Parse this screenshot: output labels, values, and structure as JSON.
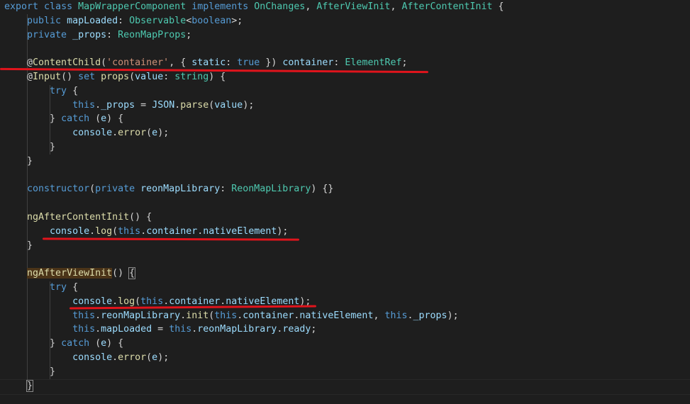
{
  "editor": {
    "lines": [
      [
        {
          "t": "export",
          "c": "kw"
        },
        {
          "t": " class ",
          "c": "kw"
        },
        {
          "t": "MapWrapperComponent",
          "c": "ty"
        },
        {
          "t": " implements ",
          "c": "kw"
        },
        {
          "t": "OnChanges",
          "c": "ty"
        },
        {
          "t": ", ",
          "c": "pl"
        },
        {
          "t": "AfterViewInit",
          "c": "ty"
        },
        {
          "t": ", ",
          "c": "pl"
        },
        {
          "t": "AfterContentInit",
          "c": "ty"
        },
        {
          "t": " {",
          "c": "pl"
        }
      ],
      [
        {
          "t": "    public ",
          "c": "kw"
        },
        {
          "t": "mapLoaded",
          "c": "va"
        },
        {
          "t": ": ",
          "c": "pl"
        },
        {
          "t": "Observable",
          "c": "ty"
        },
        {
          "t": "<",
          "c": "pl"
        },
        {
          "t": "boolean",
          "c": "kw"
        },
        {
          "t": ">;",
          "c": "pl"
        }
      ],
      [
        {
          "t": "    private ",
          "c": "kw"
        },
        {
          "t": "_props",
          "c": "va"
        },
        {
          "t": ": ",
          "c": "pl"
        },
        {
          "t": "ReonMapProps",
          "c": "ty"
        },
        {
          "t": ";",
          "c": "pl"
        }
      ],
      [],
      [
        {
          "t": "    @",
          "c": "pl"
        },
        {
          "t": "ContentChild",
          "c": "fn"
        },
        {
          "t": "(",
          "c": "pl"
        },
        {
          "t": "'container'",
          "c": "st"
        },
        {
          "t": ", { ",
          "c": "pl"
        },
        {
          "t": "static",
          "c": "va"
        },
        {
          "t": ": ",
          "c": "pl"
        },
        {
          "t": "true",
          "c": "kw"
        },
        {
          "t": " }) ",
          "c": "pl"
        },
        {
          "t": "container",
          "c": "va"
        },
        {
          "t": ": ",
          "c": "pl"
        },
        {
          "t": "ElementRef",
          "c": "ty"
        },
        {
          "t": ";",
          "c": "pl"
        }
      ],
      [
        {
          "t": "    @",
          "c": "pl"
        },
        {
          "t": "Input",
          "c": "fn"
        },
        {
          "t": "() ",
          "c": "pl"
        },
        {
          "t": "set ",
          "c": "kw"
        },
        {
          "t": "props",
          "c": "fn"
        },
        {
          "t": "(",
          "c": "pl"
        },
        {
          "t": "value",
          "c": "va"
        },
        {
          "t": ": ",
          "c": "pl"
        },
        {
          "t": "string",
          "c": "ty"
        },
        {
          "t": ") {",
          "c": "pl"
        }
      ],
      [
        {
          "t": "        try",
          "c": "kw"
        },
        {
          "t": " {",
          "c": "pl"
        }
      ],
      [
        {
          "t": "            this",
          "c": "kw"
        },
        {
          "t": ".",
          "c": "pl"
        },
        {
          "t": "_props",
          "c": "va"
        },
        {
          "t": " = ",
          "c": "pl"
        },
        {
          "t": "JSON",
          "c": "va"
        },
        {
          "t": ".",
          "c": "pl"
        },
        {
          "t": "parse",
          "c": "fn"
        },
        {
          "t": "(",
          "c": "pl"
        },
        {
          "t": "value",
          "c": "va"
        },
        {
          "t": ");",
          "c": "pl"
        }
      ],
      [
        {
          "t": "        } ",
          "c": "pl"
        },
        {
          "t": "catch",
          "c": "kw"
        },
        {
          "t": " (",
          "c": "pl"
        },
        {
          "t": "e",
          "c": "va"
        },
        {
          "t": ") {",
          "c": "pl"
        }
      ],
      [
        {
          "t": "            console",
          "c": "va"
        },
        {
          "t": ".",
          "c": "pl"
        },
        {
          "t": "error",
          "c": "fn"
        },
        {
          "t": "(",
          "c": "pl"
        },
        {
          "t": "e",
          "c": "va"
        },
        {
          "t": ");",
          "c": "pl"
        }
      ],
      [
        {
          "t": "        }",
          "c": "pl"
        }
      ],
      [
        {
          "t": "    }",
          "c": "pl"
        }
      ],
      [],
      [
        {
          "t": "    constructor",
          "c": "kw"
        },
        {
          "t": "(",
          "c": "pl"
        },
        {
          "t": "private ",
          "c": "kw"
        },
        {
          "t": "reonMapLibrary",
          "c": "va"
        },
        {
          "t": ": ",
          "c": "pl"
        },
        {
          "t": "ReonMapLibrary",
          "c": "ty"
        },
        {
          "t": ") {}",
          "c": "pl"
        }
      ],
      [],
      [
        {
          "t": "    ngAfterContentInit",
          "c": "fn"
        },
        {
          "t": "() {",
          "c": "pl"
        }
      ],
      [
        {
          "t": "        console",
          "c": "va"
        },
        {
          "t": ".",
          "c": "pl"
        },
        {
          "t": "log",
          "c": "fn"
        },
        {
          "t": "(",
          "c": "pl"
        },
        {
          "t": "this",
          "c": "kw"
        },
        {
          "t": ".",
          "c": "pl"
        },
        {
          "t": "container",
          "c": "va"
        },
        {
          "t": ".",
          "c": "pl"
        },
        {
          "t": "nativeElement",
          "c": "va"
        },
        {
          "t": ");",
          "c": "pl"
        }
      ],
      [
        {
          "t": "    }",
          "c": "pl"
        }
      ],
      [],
      [
        {
          "t": "    ",
          "c": "pl"
        },
        {
          "t": "ngAfterViewInit",
          "c": "fn",
          "h": 1
        },
        {
          "t": "() ",
          "c": "pl"
        },
        {
          "t": "{",
          "c": "pl",
          "b": 1
        }
      ],
      [
        {
          "t": "        try",
          "c": "kw"
        },
        {
          "t": " {",
          "c": "pl"
        }
      ],
      [
        {
          "t": "            console",
          "c": "va"
        },
        {
          "t": ".",
          "c": "pl"
        },
        {
          "t": "log",
          "c": "fn"
        },
        {
          "t": "(",
          "c": "pl"
        },
        {
          "t": "this",
          "c": "kw"
        },
        {
          "t": ".",
          "c": "pl"
        },
        {
          "t": "container",
          "c": "va"
        },
        {
          "t": ".",
          "c": "pl"
        },
        {
          "t": "nativeElement",
          "c": "va"
        },
        {
          "t": ");",
          "c": "pl"
        }
      ],
      [
        {
          "t": "            this",
          "c": "kw"
        },
        {
          "t": ".",
          "c": "pl"
        },
        {
          "t": "reonMapLibrary",
          "c": "va"
        },
        {
          "t": ".",
          "c": "pl"
        },
        {
          "t": "init",
          "c": "fn"
        },
        {
          "t": "(",
          "c": "pl"
        },
        {
          "t": "this",
          "c": "kw"
        },
        {
          "t": ".",
          "c": "pl"
        },
        {
          "t": "container",
          "c": "va"
        },
        {
          "t": ".",
          "c": "pl"
        },
        {
          "t": "nativeElement",
          "c": "va"
        },
        {
          "t": ", ",
          "c": "pl"
        },
        {
          "t": "this",
          "c": "kw"
        },
        {
          "t": ".",
          "c": "pl"
        },
        {
          "t": "_props",
          "c": "va"
        },
        {
          "t": ");",
          "c": "pl"
        }
      ],
      [
        {
          "t": "            this",
          "c": "kw"
        },
        {
          "t": ".",
          "c": "pl"
        },
        {
          "t": "mapLoaded",
          "c": "va"
        },
        {
          "t": " = ",
          "c": "pl"
        },
        {
          "t": "this",
          "c": "kw"
        },
        {
          "t": ".",
          "c": "pl"
        },
        {
          "t": "reonMapLibrary",
          "c": "va"
        },
        {
          "t": ".",
          "c": "pl"
        },
        {
          "t": "ready",
          "c": "va"
        },
        {
          "t": ";",
          "c": "pl"
        }
      ],
      [
        {
          "t": "        } ",
          "c": "pl"
        },
        {
          "t": "catch",
          "c": "kw"
        },
        {
          "t": " (",
          "c": "pl"
        },
        {
          "t": "e",
          "c": "va"
        },
        {
          "t": ") {",
          "c": "pl"
        }
      ],
      [
        {
          "t": "            console",
          "c": "va"
        },
        {
          "t": ".",
          "c": "pl"
        },
        {
          "t": "error",
          "c": "fn"
        },
        {
          "t": "(",
          "c": "pl"
        },
        {
          "t": "e",
          "c": "va"
        },
        {
          "t": ");",
          "c": "pl"
        }
      ],
      [
        {
          "t": "        }",
          "c": "pl"
        }
      ],
      [
        {
          "t": "    ",
          "c": "pl"
        },
        {
          "t": "}",
          "c": "pl",
          "b": 1
        }
      ]
    ]
  },
  "colors": {
    "background": "#1e1e1e",
    "keyword": "#569cd6",
    "type": "#4ec9b0",
    "function": "#dcdcaa",
    "variable": "#9cdcfe",
    "string": "#ce9178",
    "plain": "#d4d4d4",
    "annotation_underline": "#e0141c"
  }
}
